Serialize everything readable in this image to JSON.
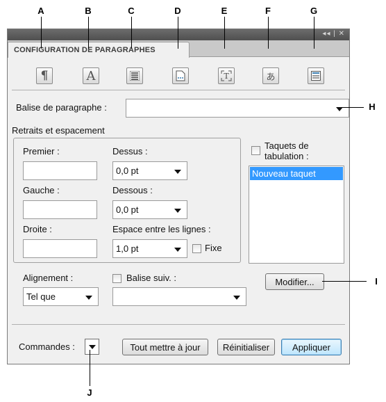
{
  "callouts": {
    "a": "A",
    "b": "B",
    "c": "C",
    "d": "D",
    "e": "E",
    "f": "F",
    "g": "G",
    "h": "H",
    "i": "I",
    "j": "J"
  },
  "panel": {
    "title_controls": "◂◂ | ✕",
    "tab_label": "CONFIGURATION DE PARAGRAPHES",
    "icons": {
      "pilcrow": "¶",
      "character_a": "A",
      "japanese": "あ"
    }
  },
  "paragraph_tag": {
    "label": "Balise de paragraphe :",
    "value": ""
  },
  "indents": {
    "section_title": "Retraits et espacement",
    "first_label": "Premier :",
    "first_value": "",
    "left_label": "Gauche :",
    "left_value": "",
    "right_label": "Droite :",
    "right_value": "",
    "above_label": "Dessus :",
    "above_value": "0,0 pt",
    "below_label": "Dessous :",
    "below_value": "0,0 pt",
    "line_spacing_label": "Espace entre les lignes :",
    "line_spacing_value": "1,0 pt",
    "fixed_label": "Fixe"
  },
  "tabs_group": {
    "checkbox_label": "Taquets de tabulation :",
    "items": [
      "Nouveau taquet"
    ],
    "selected_index": 0,
    "modify_button": "Modifier..."
  },
  "alignment": {
    "label": "Alignement :",
    "value": "Tel que"
  },
  "next_tag": {
    "checkbox_label": "Balise suiv. :",
    "value": ""
  },
  "footer": {
    "commands_label": "Commandes :",
    "update_all_button": "Tout mettre à jour",
    "reset_button": "Réinitialiser",
    "apply_button": "Appliquer"
  },
  "colors": {
    "selection": "#3399ff",
    "panel_bg": "#f0f0f0",
    "titlebar": "#5a5a5a"
  }
}
